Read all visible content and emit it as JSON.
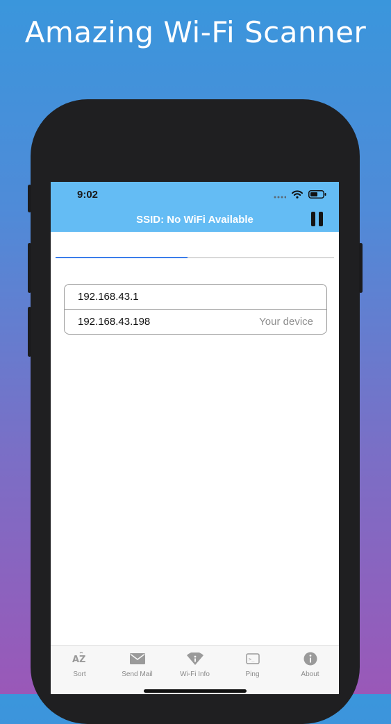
{
  "promo": {
    "title": "Amazing Wi-Fi Scanner"
  },
  "status_bar": {
    "time": "9:02",
    "icons": [
      "cellular-dots-icon",
      "wifi-icon",
      "battery-icon"
    ]
  },
  "nav": {
    "title": "SSID: No WiFi Available",
    "pause_icon": "pause-icon"
  },
  "scan_progress": {
    "fraction": 0.475
  },
  "devices": [
    {
      "ip": "192.168.43.1",
      "note": ""
    },
    {
      "ip": "192.168.43.198",
      "note": "Your device"
    }
  ],
  "tabs": [
    {
      "label": "Sort",
      "icon": "sort-az-icon"
    },
    {
      "label": "Send Mail",
      "icon": "mail-icon"
    },
    {
      "label": "Wi-Fi Info",
      "icon": "wifi-info-icon"
    },
    {
      "label": "Ping",
      "icon": "ping-icon"
    },
    {
      "label": "About",
      "icon": "info-icon"
    }
  ],
  "colors": {
    "nav_bar": "#64bcf4",
    "progress": "#3b7dea",
    "bg_top": "#3a96dc",
    "bg_bottom": "#9a58b8"
  }
}
